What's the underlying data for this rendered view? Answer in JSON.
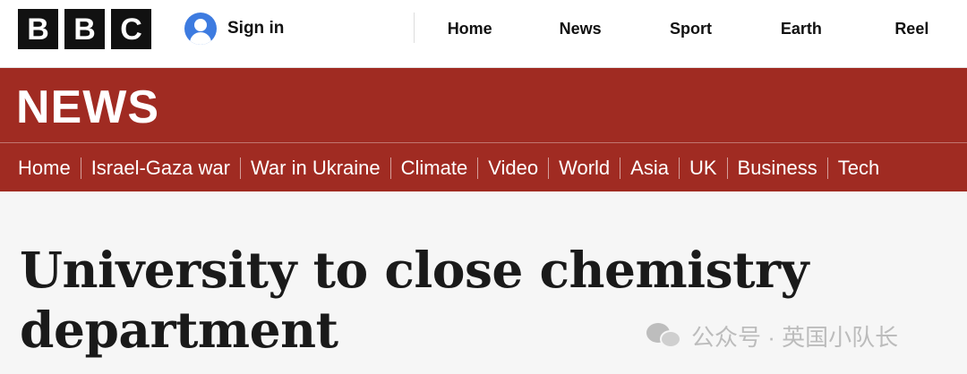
{
  "brand": {
    "letters": [
      "B",
      "B",
      "C"
    ]
  },
  "account": {
    "signin_label": "Sign in"
  },
  "top_nav": [
    {
      "label": "Home"
    },
    {
      "label": "News"
    },
    {
      "label": "Sport"
    },
    {
      "label": "Earth"
    },
    {
      "label": "Reel"
    }
  ],
  "section": {
    "title": "NEWS",
    "accent_color": "#a02b22"
  },
  "sub_nav": [
    {
      "label": "Home"
    },
    {
      "label": "Israel-Gaza war"
    },
    {
      "label": "War in Ukraine"
    },
    {
      "label": "Climate"
    },
    {
      "label": "Video"
    },
    {
      "label": "World"
    },
    {
      "label": "Asia"
    },
    {
      "label": "UK"
    },
    {
      "label": "Business"
    },
    {
      "label": "Tech"
    }
  ],
  "article": {
    "headline_line1": "University to close chemistry",
    "headline_line2": "department"
  },
  "watermark": {
    "icon": "wechat-icon",
    "text": "公众号 · 英国小队长"
  }
}
